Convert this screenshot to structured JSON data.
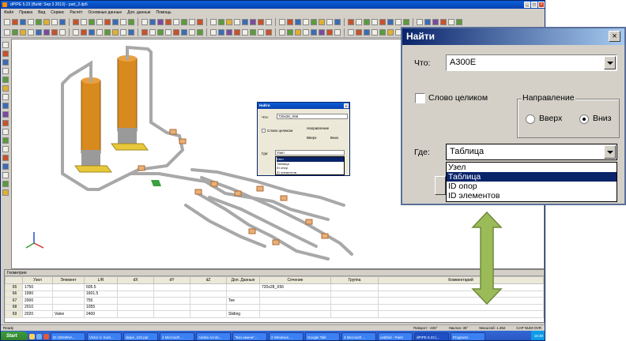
{
  "app": {
    "title": "dPIPE 5.23 (Build: Sep 3 2013) - part_2.dp5",
    "menu": [
      "Файл",
      "Правка",
      "Вид",
      "Сервис",
      "Расчёт",
      "Основные данные",
      "Доп. данные",
      "Помощь"
    ]
  },
  "small_dialog": {
    "title": "Найти",
    "what_label": "Что:",
    "what_value": "720x28_X56",
    "whole_word": "Слово целиком",
    "direction_label": "Направление",
    "up": "Вверх",
    "down": "Вниз",
    "where_label": "Где:",
    "where_value": "Узел",
    "options": [
      "Узел",
      "Таблица",
      "ID опор",
      "ID элементов"
    ]
  },
  "grid": {
    "title": "Геометрия",
    "columns": [
      "",
      "Узел",
      "Элемент",
      "L/R",
      "dX",
      "dY",
      "dZ",
      "Доп. Данные",
      "Сечение",
      "Группа",
      "Комментарий"
    ],
    "rows": [
      [
        "65",
        "1750",
        "",
        "605.5",
        "",
        "",
        "",
        "",
        "720x28_X56",
        "",
        ""
      ],
      [
        "66",
        "1990",
        "",
        "1601.5",
        "",
        "",
        "",
        "",
        "",
        "",
        ""
      ],
      [
        "67",
        "2000",
        "",
        "755",
        "",
        "",
        "",
        "Tee",
        "",
        "",
        ""
      ],
      [
        "68",
        "2010",
        "",
        "1055",
        "",
        "",
        "",
        "",
        "",
        "",
        ""
      ],
      [
        "69",
        "2020",
        "Valve",
        "2400",
        "",
        "",
        "",
        "Sliding",
        "",
        "",
        ""
      ]
    ]
  },
  "status": {
    "left": "Ready",
    "rotate": "Поворот: -225°",
    "tilt": "Наклон: 35°",
    "scale": "Масштаб: 1.362",
    "flags": "CAP  NUM  OVR"
  },
  "taskbar": {
    "start": "Start",
    "items": [
      "ID (SEMINA...",
      "Victor V. Kost...",
      "dpipe_102.ppt",
      "4 Microsoft ...",
      "Adobe Acrob...",
      "\"Без имени\"...",
      "2 Windows ...",
      "Google Talk",
      "3 Microsoft ...",
      "untitled - Paint",
      "dPIPE 5.23 (...",
      "Programs"
    ],
    "active_index": 10,
    "clock": "18:38"
  },
  "big_dialog": {
    "title": "Найти",
    "what_label": "Что:",
    "what_value": "A300E",
    "whole_word": "Слово целиком",
    "direction_label": "Направление",
    "up": "Вверх",
    "down": "Вниз",
    "where_label": "Где:",
    "where_value": "Таблица",
    "options": [
      "Узел",
      "Таблица",
      "ID опор",
      "ID элементов"
    ],
    "selected_option": 1,
    "down_selected": true
  },
  "colors": {
    "arrow_fill": "#9bbb59",
    "arrow_stroke": "#6f8a3a",
    "pipe": "#b0b0b0",
    "vessel": "#d88a1e",
    "support": "#e8c83a"
  }
}
